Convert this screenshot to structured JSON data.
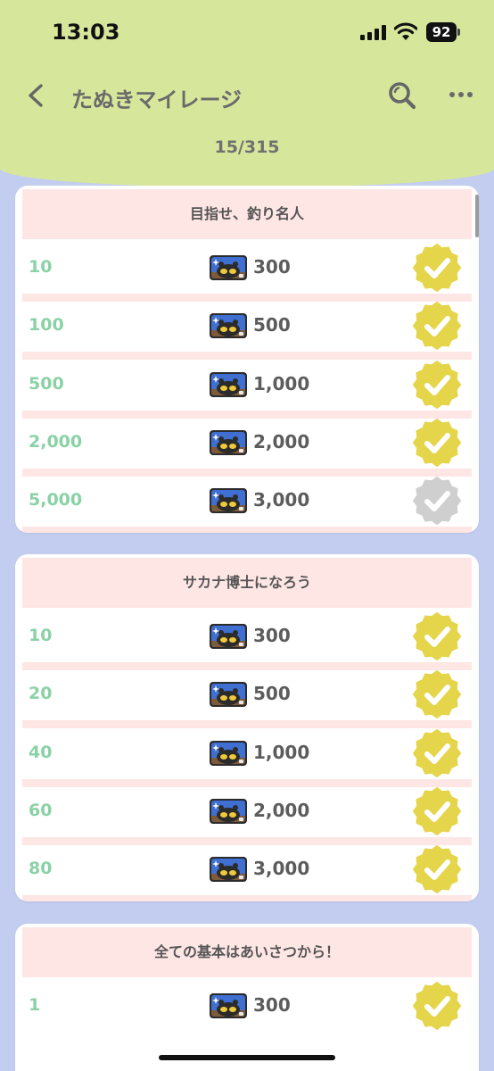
{
  "status_bar": {
    "time": "13:03",
    "battery": "92"
  },
  "nav": {
    "title": "たぬきマイレージ"
  },
  "progress": {
    "counter": "15/315"
  },
  "colors": {
    "header_bg": "#d6e79c",
    "page_bg": "#c2cdef",
    "row_sep": "#fde6e4",
    "goal_text": "#8ad2a6",
    "badge_done": "#e4d54a",
    "badge_pending": "#cfcfcf"
  },
  "icons": {
    "ticket": "tanuki-ticket-icon",
    "done": "check-badge-icon"
  },
  "sections": [
    {
      "title": "目指せ、釣り名人",
      "rows": [
        {
          "goal": "10",
          "reward": "300",
          "done": true
        },
        {
          "goal": "100",
          "reward": "500",
          "done": true
        },
        {
          "goal": "500",
          "reward": "1,000",
          "done": true
        },
        {
          "goal": "2,000",
          "reward": "2,000",
          "done": true
        },
        {
          "goal": "5,000",
          "reward": "3,000",
          "done": false
        }
      ]
    },
    {
      "title": "サカナ博士になろう",
      "rows": [
        {
          "goal": "10",
          "reward": "300",
          "done": true
        },
        {
          "goal": "20",
          "reward": "500",
          "done": true
        },
        {
          "goal": "40",
          "reward": "1,000",
          "done": true
        },
        {
          "goal": "60",
          "reward": "2,000",
          "done": true
        },
        {
          "goal": "80",
          "reward": "3,000",
          "done": true
        }
      ]
    },
    {
      "title": "全ての基本はあいさつから！",
      "rows": [
        {
          "goal": "1",
          "reward": "300",
          "done": true
        }
      ]
    }
  ]
}
